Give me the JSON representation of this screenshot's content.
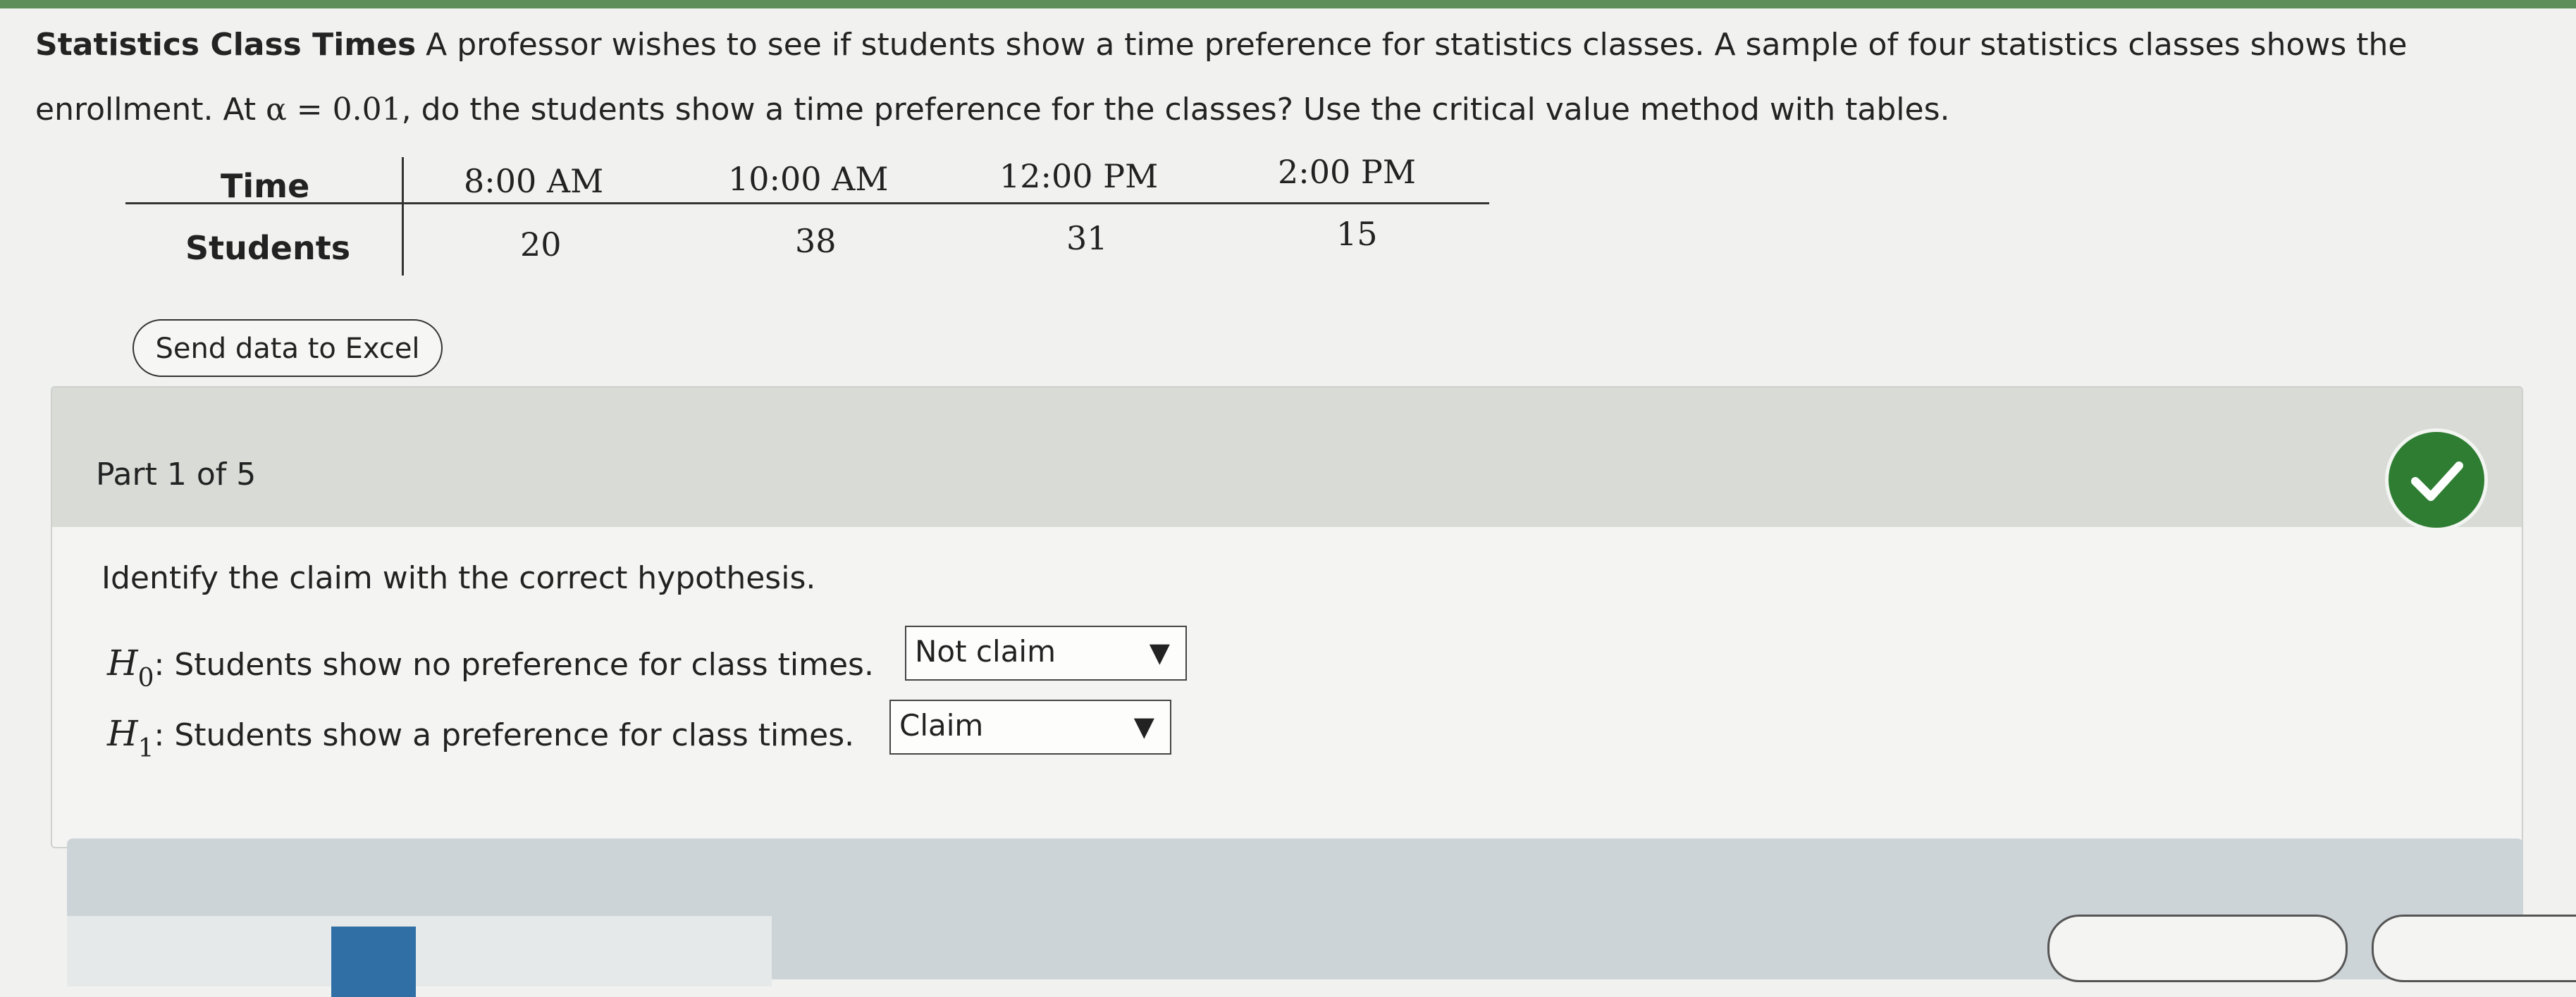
{
  "problem": {
    "title": "Statistics Class Times",
    "text_1": " A professor wishes to see if students show a time preference for statistics classes. A sample of four statistics classes shows the enrollment. At ",
    "alpha_expr": "α = 0.01",
    "text_2": ", do the students show a time preference for the classes? Use the critical value method with tables."
  },
  "table": {
    "row_headers": [
      "Time",
      "Students"
    ],
    "times": [
      "8:00 AM",
      "10:00 AM",
      "12:00 PM",
      "2:00 PM"
    ],
    "students": [
      "20",
      "38",
      "31",
      "15"
    ]
  },
  "excel_button": "Send data to Excel",
  "part": {
    "title": "Part 1 of 5",
    "status": "correct",
    "question": "Identify the claim with the correct hypothesis.",
    "h0": {
      "symbol": "H",
      "sub": "0",
      "text": ": Students show no preference for class times.",
      "selected": "Not claim"
    },
    "h1": {
      "symbol": "H",
      "sub": "1",
      "text": ": Students show a preference for class times.",
      "selected": "Claim"
    }
  },
  "colors": {
    "check_badge": "#2e7d32",
    "header_band": "#d9dbd7",
    "accent_blue": "#2f6fa5"
  }
}
